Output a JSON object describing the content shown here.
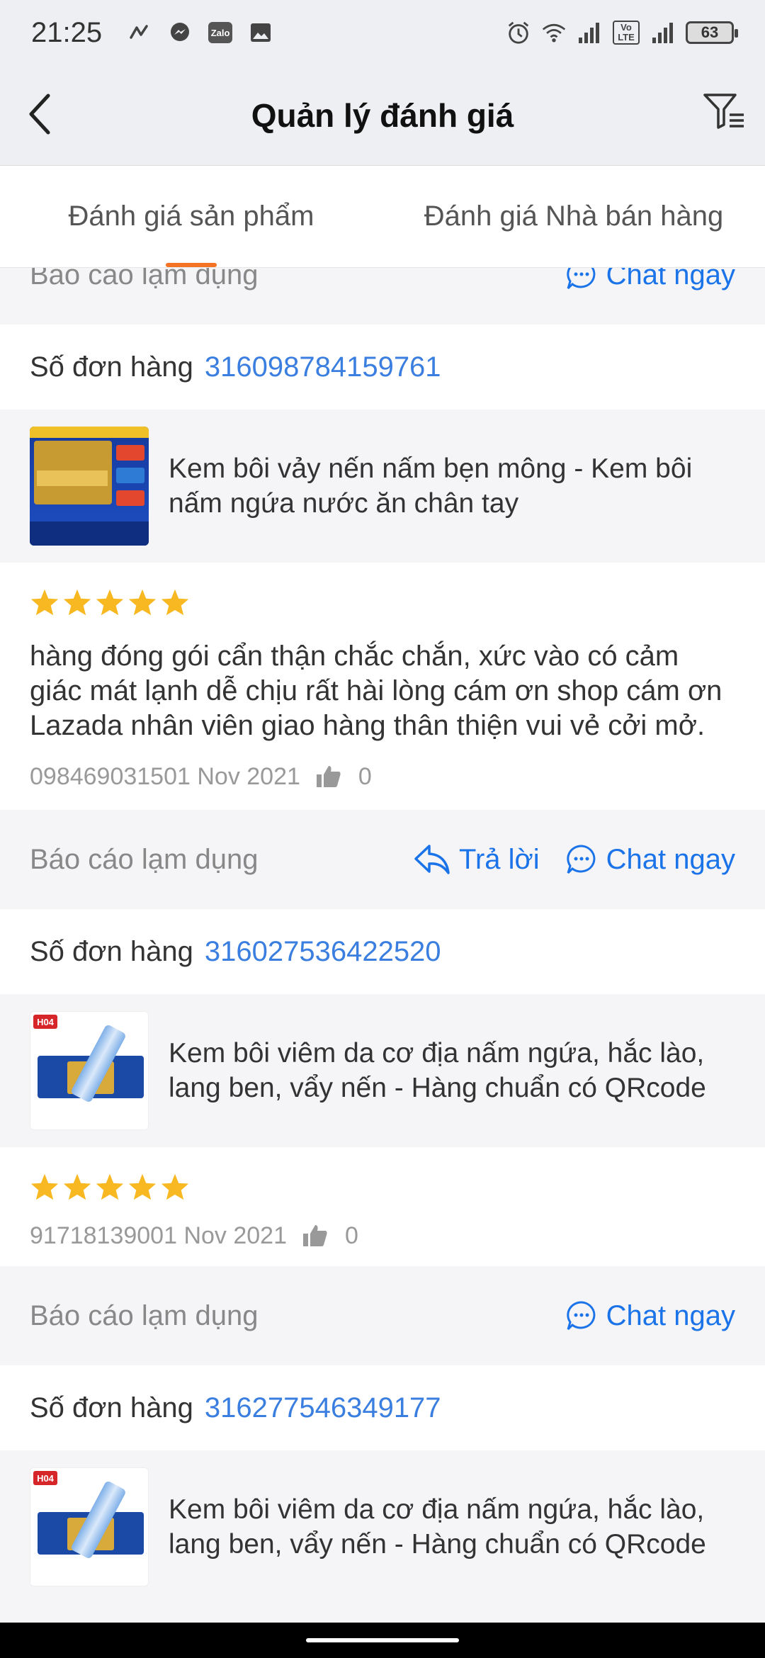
{
  "status_bar": {
    "time": "21:25",
    "battery": "63",
    "icons": [
      "signal-app-icon",
      "messenger-icon",
      "zalo-icon",
      "image-icon",
      "alarm-icon",
      "wifi-icon",
      "signal-icon",
      "volte-icon",
      "signal-icon",
      "battery-icon"
    ],
    "zalo_label": "Zalo",
    "volte_label": "Vo LTE"
  },
  "header": {
    "title": "Quản lý đánh giá"
  },
  "tabs": [
    {
      "label": "Đánh giá sản phẩm",
      "active": true
    },
    {
      "label": "Đánh giá Nhà bán hàng",
      "active": false
    }
  ],
  "labels": {
    "report": "Báo cáo lạm dụng",
    "reply": "Trả lời",
    "chat": "Chat ngay",
    "order_label": "Số đơn hàng"
  },
  "reviews": [
    {
      "order_no": "316098784159761",
      "product_name": "Kem bôi vảy nến nấm bẹn mông - Kem bôi nấm ngứa nước ăn chân tay",
      "thumb_badge": "",
      "stars": 5,
      "text": "hàng đóng gói cẩn thận chắc chắn, xức vào có cảm giác mát lạnh dễ chịu rất hài lòng cám ơn shop cám ơn Lazada nhân viên giao hàng thân thiện vui vẻ cởi mở.",
      "meta": "098469031501 Nov 2021",
      "likes": "0"
    },
    {
      "order_no": "316027536422520",
      "product_name": "Kem bôi viêm da cơ địa nấm ngứa, hắc lào, lang ben, vẩy nến - Hàng chuẩn có QRcode",
      "thumb_badge": "H04",
      "stars": 5,
      "text": "",
      "meta": "91718139001 Nov 2021",
      "likes": "0"
    },
    {
      "order_no": "316277546349177",
      "product_name": "Kem bôi viêm da cơ địa nấm ngứa, hắc lào, lang ben, vẩy nến - Hàng chuẩn có QRcode",
      "thumb_badge": "H04"
    }
  ],
  "colors": {
    "accent": "#f57224",
    "link": "#1a73e8",
    "star": "#f8b822",
    "header_bg": "#eeeff2"
  }
}
